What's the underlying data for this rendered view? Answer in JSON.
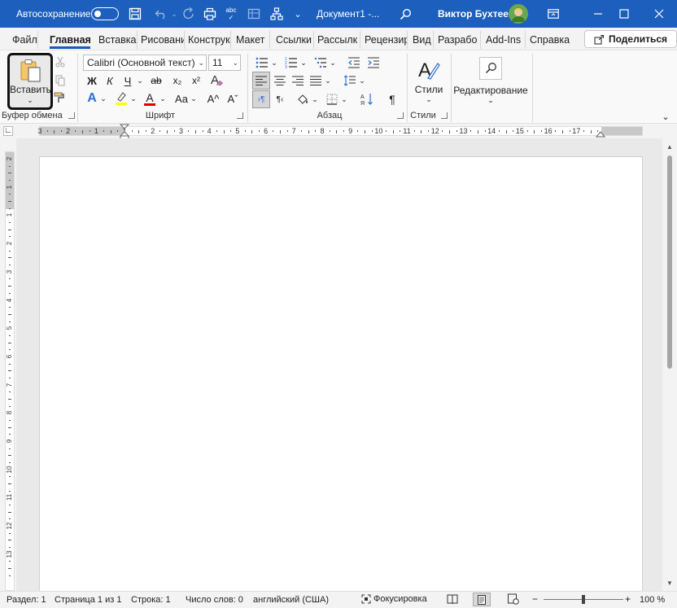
{
  "titlebar": {
    "autosave_label": "Автосохранение",
    "document_name": "Документ1 -...",
    "user_name": "Виктор Бухтеев",
    "colors": {
      "bar": "#1d5fbd",
      "text": "#ffffff"
    }
  },
  "tabs": [
    {
      "label": "Файл"
    },
    {
      "label": "Главная"
    },
    {
      "label": "Вставка"
    },
    {
      "label": "Рисовани"
    },
    {
      "label": "Конструк"
    },
    {
      "label": "Макет"
    },
    {
      "label": "Ссылки"
    },
    {
      "label": "Рассылк"
    },
    {
      "label": "Рецензир"
    },
    {
      "label": "Вид"
    },
    {
      "label": "Разрабо"
    },
    {
      "label": "Add-Ins"
    },
    {
      "label": "Справка"
    }
  ],
  "share_label": "Поделиться",
  "ribbon": {
    "clipboard": {
      "paste_label": "Вставить",
      "group_label": "Буфер обмена"
    },
    "font": {
      "font_name": "Calibri (Основной текст)",
      "font_size": "11",
      "bold_label": "Ж",
      "italic_label": "К",
      "underline_label": "Ч",
      "strike_label": "ab",
      "subscript_label": "x₂",
      "superscript_label": "x²",
      "case_label": "Aa",
      "grow_label": "A^",
      "shrink_label": "Aˇ",
      "clear_label": "A",
      "effects_label": "A",
      "font_color_label": "A",
      "group_label": "Шрифт",
      "highlight_color": "#ffff00",
      "font_color": "#e00000"
    },
    "paragraph": {
      "group_label": "Абзац",
      "pilcrow": "¶"
    },
    "styles": {
      "label": "Стили",
      "group_label": "Стили"
    },
    "editing": {
      "label": "Редактирование"
    }
  },
  "hruler_ticks": [
    "3",
    "2",
    "1",
    "1",
    "2",
    "3",
    "4",
    "5",
    "6",
    "7",
    "8",
    "9",
    "10",
    "11",
    "12",
    "13",
    "14",
    "15",
    "16",
    "17"
  ],
  "vruler_ticks": [
    "2",
    "1",
    "1",
    "2",
    "3",
    "4",
    "5",
    "6",
    "7",
    "8",
    "9",
    "10",
    "11",
    "12",
    "13"
  ],
  "statusbar": {
    "section": "Раздел: 1",
    "page": "Страница 1 из 1",
    "line": "Строка: 1",
    "words": "Число слов: 0",
    "language": "английский (США)",
    "focus": "Фокусировка",
    "zoom": "100 %",
    "zoom_level_percent": 100
  }
}
